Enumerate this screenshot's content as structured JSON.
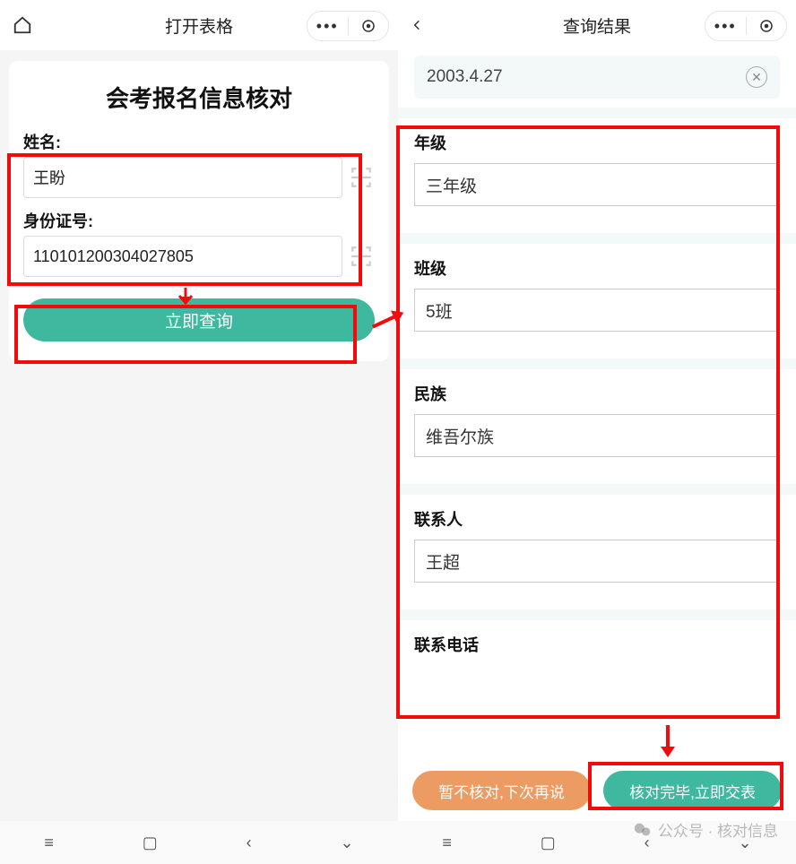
{
  "left": {
    "topbar_title": "打开表格",
    "card_title": "会考报名信息核对",
    "name_label": "姓名:",
    "name_value": "王盼",
    "id_label": "身份证号:",
    "id_value": "110101200304027805",
    "query_button": "立即查询"
  },
  "right": {
    "topbar_title": "查询结果",
    "date_value": "2003.4.27",
    "sections": {
      "grade_label": "年级",
      "grade_value": "三年级",
      "class_label": "班级",
      "class_value": "5班",
      "ethnic_label": "民族",
      "ethnic_value": "维吾尔族",
      "contact_label": "联系人",
      "contact_value": "王超",
      "phone_label": "联系电话"
    },
    "btn_later": "暂不核对,下次再说",
    "btn_submit": "核对完毕,立即交表"
  },
  "watermark": "公众号 · 核对信息"
}
